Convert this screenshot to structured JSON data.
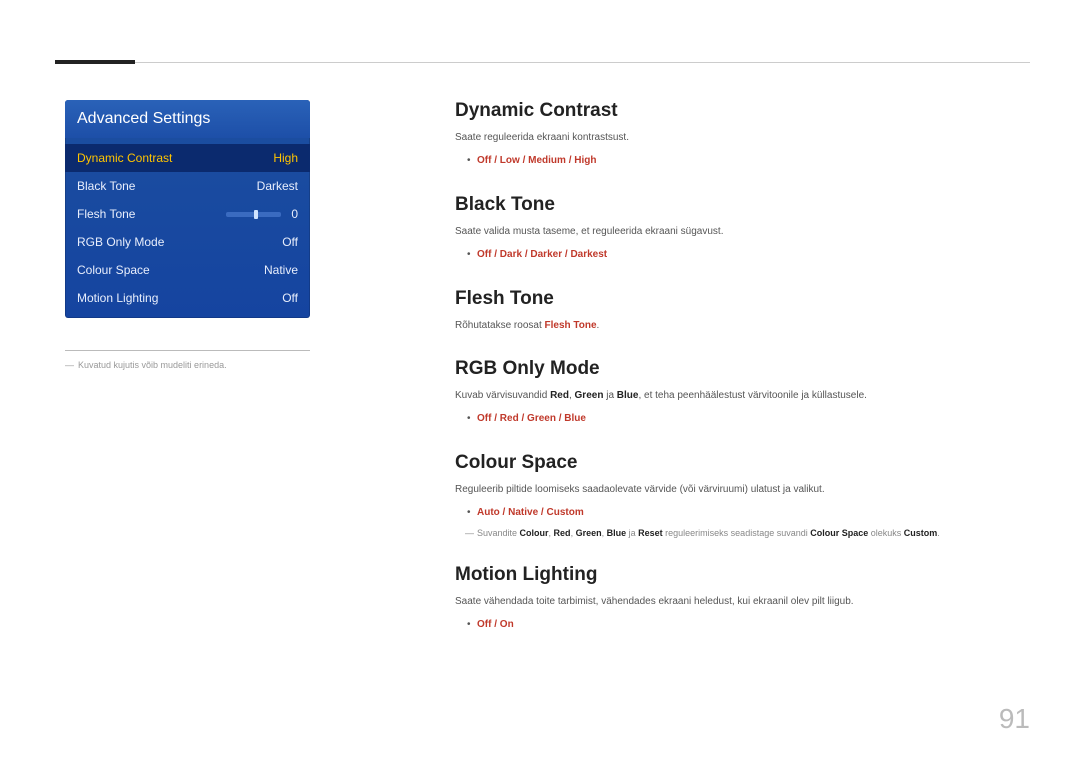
{
  "page_number": "91",
  "osd": {
    "title": "Advanced Settings",
    "rows": [
      {
        "label": "Dynamic Contrast",
        "value": "High",
        "selected": true
      },
      {
        "label": "Black Tone",
        "value": "Darkest"
      },
      {
        "label": "Flesh Tone",
        "value": "0",
        "slider": true
      },
      {
        "label": "RGB Only Mode",
        "value": "Off"
      },
      {
        "label": "Colour Space",
        "value": "Native"
      },
      {
        "label": "Motion Lighting",
        "value": "Off"
      }
    ]
  },
  "note": "Kuvatud kujutis võib mudeliti erineda.",
  "sections": {
    "dynamic_contrast": {
      "title": "Dynamic Contrast",
      "desc": "Saate reguleerida ekraani kontrastsust.",
      "opts": [
        "Off",
        "Low",
        "Medium",
        "High"
      ]
    },
    "black_tone": {
      "title": "Black Tone",
      "desc": "Saate valida musta taseme, et reguleerida ekraani sügavust.",
      "opts": [
        "Off",
        "Dark",
        "Darker",
        "Darkest"
      ]
    },
    "flesh_tone": {
      "title": "Flesh Tone",
      "desc_pre": "Rõhutatakse roosat ",
      "desc_hl": "Flesh Tone",
      "desc_post": "."
    },
    "rgb_only": {
      "title": "RGB Only Mode",
      "desc_pre": "Kuvab värvisuvandid ",
      "r": "Red",
      "g": "Green",
      "b": "Blue",
      "desc_mid1": ", ",
      "desc_mid2": " ja ",
      "desc_post": ", et teha peenhäälestust värvitoonile ja küllastusele.",
      "opts": [
        "Off",
        "Red",
        "Green",
        "Blue"
      ]
    },
    "colour_space": {
      "title": "Colour Space",
      "desc": "Reguleerib piltide loomiseks saadaolevate värvide (või värviruumi) ulatust ja valikut.",
      "opts": [
        "Auto",
        "Native",
        "Custom"
      ],
      "sub_pre": "Suvandite ",
      "sub_items": [
        "Colour",
        "Red",
        "Green",
        "Blue",
        "Reset"
      ],
      "sub_mid": " reguleerimiseks seadistage suvandi ",
      "sub_cs": "Colour Space",
      "sub_mid2": " olekuks ",
      "sub_custom": "Custom",
      "sub_end": "."
    },
    "motion_lighting": {
      "title": "Motion Lighting",
      "desc": "Saate vähendada toite tarbimist, vähendades ekraani heledust, kui ekraanil olev pilt liigub.",
      "opts": [
        "Off",
        "On"
      ]
    }
  },
  "sep": " / "
}
